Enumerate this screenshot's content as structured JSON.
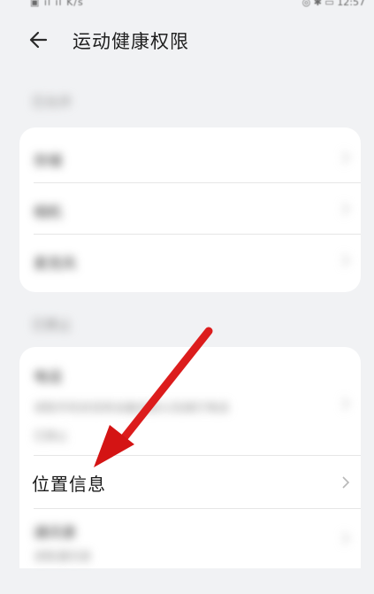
{
  "status_bar": {
    "left_text": "▣ ıl ıl K/s",
    "right_text": "◎ ✱ ▭ 12:57"
  },
  "header": {
    "title": "运动健康权限"
  },
  "section1": {
    "label": "已允许",
    "items": [
      "存储",
      "相机",
      "麦克风"
    ]
  },
  "section2": {
    "label": "已禁止",
    "items": [
      {
        "label": "电话",
        "sublabel_1": "读取手机状态和设备信息以及拨打电话",
        "sublabel_2": "已禁止"
      },
      {
        "label": "位置信息"
      },
      {
        "label": "通讯录",
        "sublabel": "读取通讯录"
      }
    ]
  },
  "colors": {
    "arrow": "#e01818",
    "background": "#f1f2f4",
    "card": "#ffffff"
  }
}
